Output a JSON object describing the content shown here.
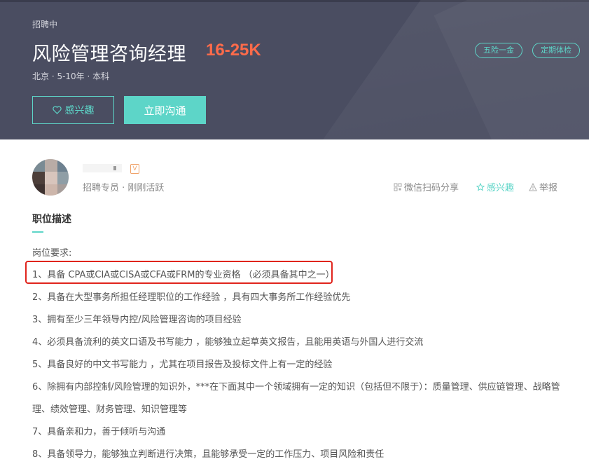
{
  "header": {
    "status": "招聘中",
    "job_title": "风险管理咨询经理",
    "salary": "16-25K",
    "meta": "北京 · 5-10年 · 本科",
    "tags": [
      "五险一金",
      "定期体检"
    ],
    "interest_label": "感兴趣",
    "contact_label": "立即沟通"
  },
  "recruiter": {
    "badge": "V",
    "role": "招聘专员 · 刚刚活跃"
  },
  "actions": {
    "share": "微信扫码分享",
    "favorite": "感兴趣",
    "report": "举报"
  },
  "description": {
    "title": "职位描述",
    "requirements_header": "岗位要求:",
    "lines": [
      "1、具备 CPA或CIA或CISA或CFA或FRM的专业资格 （必须具备其中之一）",
      "2、具备在大型事务所担任经理职位的工作经验 ，具有四大事务所工作经验优先",
      "3、拥有至少三年领导内控/风险管理咨询的项目经验",
      "4、必须具备流利的英文口语及书写能力 ，能够独立起草英文报告，且能用英语与外国人进行交流",
      "5、具备良好的中文书写能力 ，尤其在项目报告及投标文件上有一定的经验",
      "6、除拥有内部控制/风险管理的知识外，***在下面其中一个领域拥有一定的知识（包括但不限于）：质量管理、供应链管理、战略管",
      "理、绩效管理、财务管理、知识管理等",
      "7、具备亲和力，善于倾听与沟通",
      "8、具备领导力，能够独立判断进行决策，且能够承受一定的工作压力、项目风险和责任"
    ]
  },
  "colors": {
    "banner": "#4a4d61",
    "accent": "#5dd5c8",
    "salary": "#ff6b4a",
    "highlight": "#e0241c"
  },
  "icons": [
    "heart-icon",
    "qrcode-icon",
    "star-icon",
    "warning-icon",
    "vip-badge-icon"
  ]
}
